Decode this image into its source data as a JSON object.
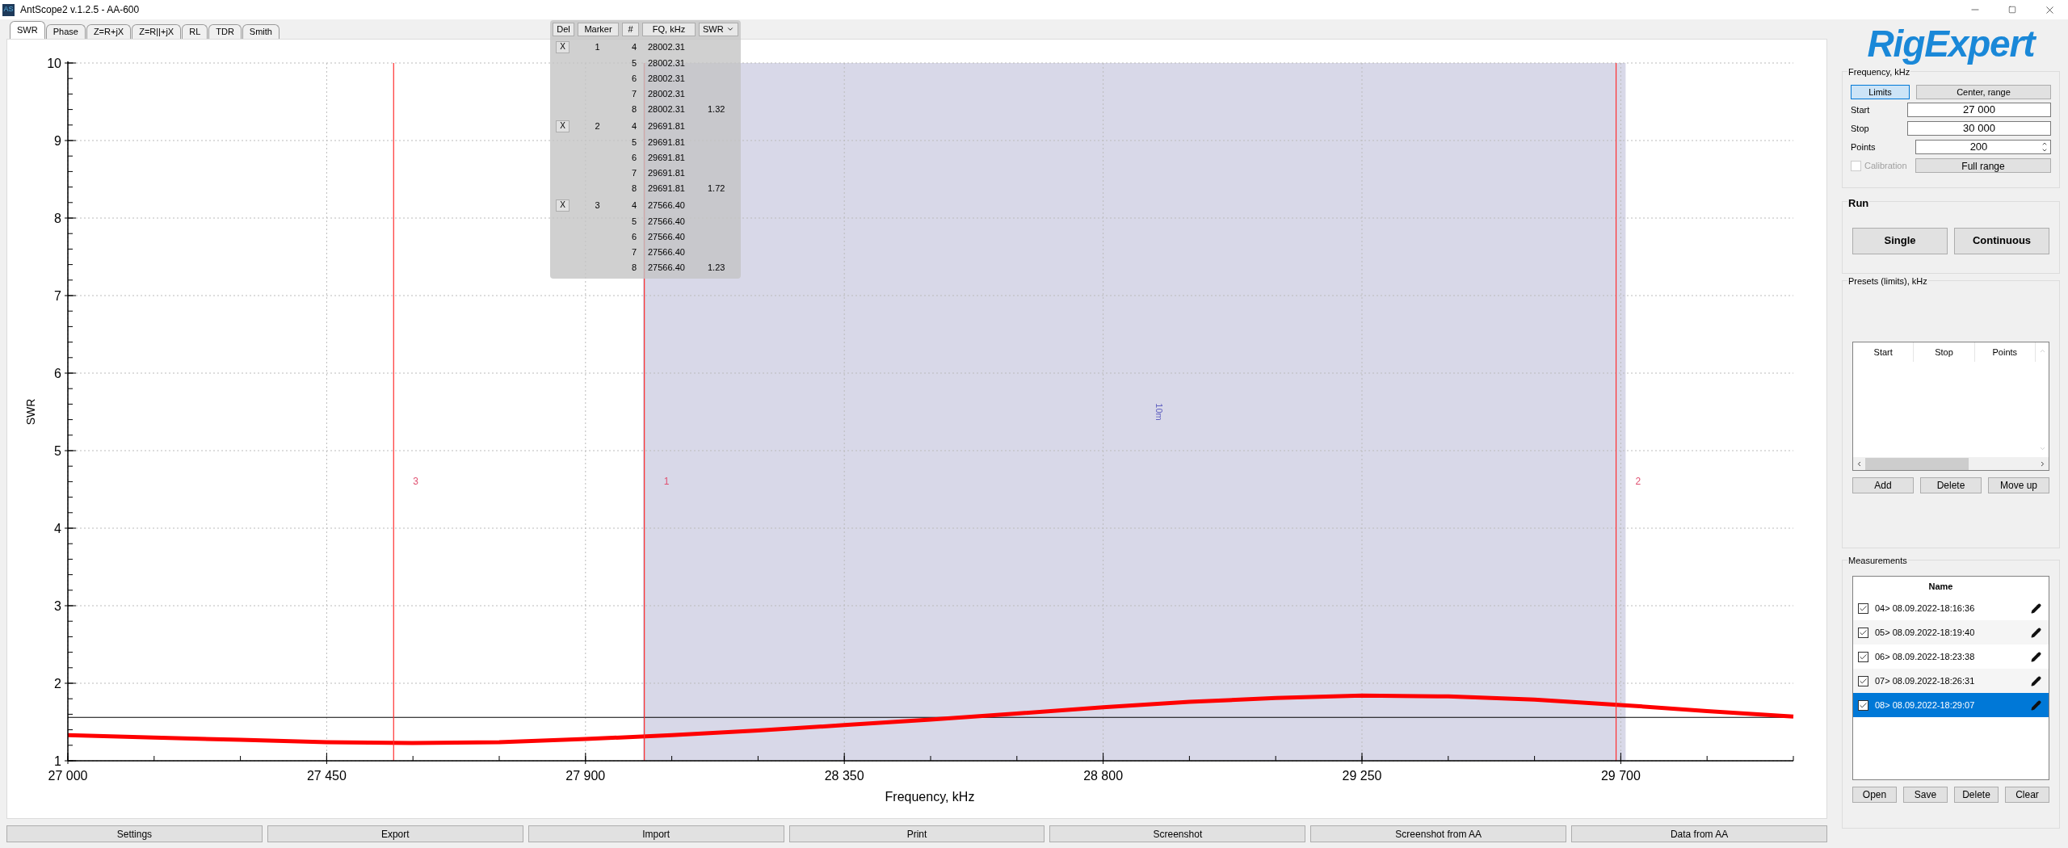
{
  "window": {
    "title": "AntScope2 v.1.2.5 - AA-600",
    "app_icon": "AS"
  },
  "tabs": [
    {
      "label": "SWR",
      "selected": true
    },
    {
      "label": "Phase",
      "selected": false
    },
    {
      "label": "Z=R+jX",
      "selected": false
    },
    {
      "label": "Z=R||+jX",
      "selected": false
    },
    {
      "label": "RL",
      "selected": false
    },
    {
      "label": "TDR",
      "selected": false
    },
    {
      "label": "Smith",
      "selected": false
    }
  ],
  "chart": {
    "chart_data": {
      "type": "line",
      "xlabel": "Frequency, kHz",
      "ylabel": "SWR",
      "xlim": [
        27000,
        30000
      ],
      "ylim": [
        1,
        10
      ],
      "xticks": [
        {
          "value": 27000,
          "label": "27 000"
        },
        {
          "value": 27450,
          "label": "27 450"
        },
        {
          "value": 27900,
          "label": "27 900"
        },
        {
          "value": 28350,
          "label": "28 350"
        },
        {
          "value": 28800,
          "label": "28 800"
        },
        {
          "value": 29250,
          "label": "29 250"
        },
        {
          "value": 29700,
          "label": "29 700"
        }
      ],
      "yticks": [
        {
          "value": 1,
          "label": "1"
        },
        {
          "value": 2,
          "label": "2"
        },
        {
          "value": 3,
          "label": "3"
        },
        {
          "value": 4,
          "label": "4"
        },
        {
          "value": 5,
          "label": "5"
        },
        {
          "value": 6,
          "label": "6"
        },
        {
          "value": 7,
          "label": "7"
        },
        {
          "value": 8,
          "label": "8"
        },
        {
          "value": 9,
          "label": "9"
        },
        {
          "value": 10,
          "label": "10"
        }
      ],
      "grid": true,
      "x": [
        27000,
        27150,
        27300,
        27450,
        27600,
        27750,
        27900,
        28050,
        28200,
        28350,
        28500,
        28650,
        28800,
        28950,
        29100,
        29250,
        29400,
        29550,
        29700,
        29850,
        30000
      ],
      "series": [
        {
          "color": "#ff0000",
          "values": [
            1.33,
            1.3,
            1.27,
            1.24,
            1.23,
            1.24,
            1.28,
            1.33,
            1.39,
            1.46,
            1.53,
            1.61,
            1.69,
            1.76,
            1.81,
            1.84,
            1.83,
            1.79,
            1.72,
            1.64,
            1.57
          ]
        }
      ],
      "bands": [
        {
          "axis": "x",
          "from": 28000,
          "to": 29700,
          "label": "10m"
        }
      ],
      "ref_lines": [
        {
          "axis": "x",
          "value": 27566.4
        },
        {
          "axis": "x",
          "value": 28002.31
        },
        {
          "axis": "x",
          "value": 29691.81
        },
        {
          "axis": "y",
          "value": 1.56
        }
      ],
      "annotations": [
        {
          "x": 27566.4,
          "y": 4.6,
          "text": "3"
        },
        {
          "x": 28002.31,
          "y": 4.6,
          "text": "1"
        },
        {
          "x": 29691.81,
          "y": 4.6,
          "text": "2"
        }
      ]
    }
  },
  "marker_table": {
    "columns": [
      "Del",
      "Marker",
      "#",
      "FQ, kHz",
      "SWR"
    ],
    "groups": [
      {
        "delete": "X",
        "marker": "1",
        "rows": [
          {
            "index": "4",
            "frequency": "28002.31"
          },
          {
            "index": "5",
            "frequency": "28002.31"
          },
          {
            "index": "6",
            "frequency": "28002.31"
          },
          {
            "index": "7",
            "frequency": "28002.31"
          },
          {
            "index": "8",
            "frequency": "28002.31",
            "swr": "1.32"
          }
        ]
      },
      {
        "delete": "X",
        "marker": "2",
        "rows": [
          {
            "index": "4",
            "frequency": "29691.81"
          },
          {
            "index": "5",
            "frequency": "29691.81"
          },
          {
            "index": "6",
            "frequency": "29691.81"
          },
          {
            "index": "7",
            "frequency": "29691.81"
          },
          {
            "index": "8",
            "frequency": "29691.81",
            "swr": "1.72"
          }
        ]
      },
      {
        "delete": "X",
        "marker": "3",
        "rows": [
          {
            "index": "4",
            "frequency": "27566.40"
          },
          {
            "index": "5",
            "frequency": "27566.40"
          },
          {
            "index": "6",
            "frequency": "27566.40"
          },
          {
            "index": "7",
            "frequency": "27566.40"
          },
          {
            "index": "8",
            "frequency": "27566.40",
            "swr": "1.23"
          }
        ]
      }
    ]
  },
  "bottom_buttons": [
    "Settings",
    "Export",
    "Import",
    "Print",
    "Screenshot",
    "Screenshot from AA",
    "Data from AA"
  ],
  "logo": "RigExpert",
  "frequency": {
    "title": "Frequency, kHz",
    "modes": [
      {
        "label": "Limits",
        "selected": true
      },
      {
        "label": "Center, range",
        "selected": false
      }
    ],
    "fields": [
      {
        "label": "Start",
        "value": "27 000"
      },
      {
        "label": "Stop",
        "value": "30 000"
      },
      {
        "label": "Points",
        "value": "200",
        "kind": "spin"
      }
    ],
    "calibration": {
      "label": "Calibration",
      "checked": false,
      "disabled": true
    },
    "full_range": "Full range"
  },
  "run": {
    "title": "Run",
    "buttons": [
      "Single",
      "Continuous"
    ]
  },
  "presets": {
    "title": "Presets (limits), kHz",
    "columns": [
      "Start",
      "Stop",
      "Points"
    ],
    "buttons": [
      "Add",
      "Delete",
      "Move up"
    ]
  },
  "measurements": {
    "title": "Measurements",
    "column": "Name",
    "items": [
      {
        "name": "04> 08.09.2022-18:16:36",
        "checked": true,
        "selected": false
      },
      {
        "name": "05> 08.09.2022-18:19:40",
        "checked": true,
        "selected": false
      },
      {
        "name": "06> 08.09.2022-18:23:38",
        "checked": true,
        "selected": false
      },
      {
        "name": "07> 08.09.2022-18:26:31",
        "checked": true,
        "selected": false
      },
      {
        "name": "08> 08.09.2022-18:29:07",
        "checked": true,
        "selected": true
      }
    ],
    "buttons": [
      "Open",
      "Save",
      "Delete",
      "Clear"
    ]
  }
}
